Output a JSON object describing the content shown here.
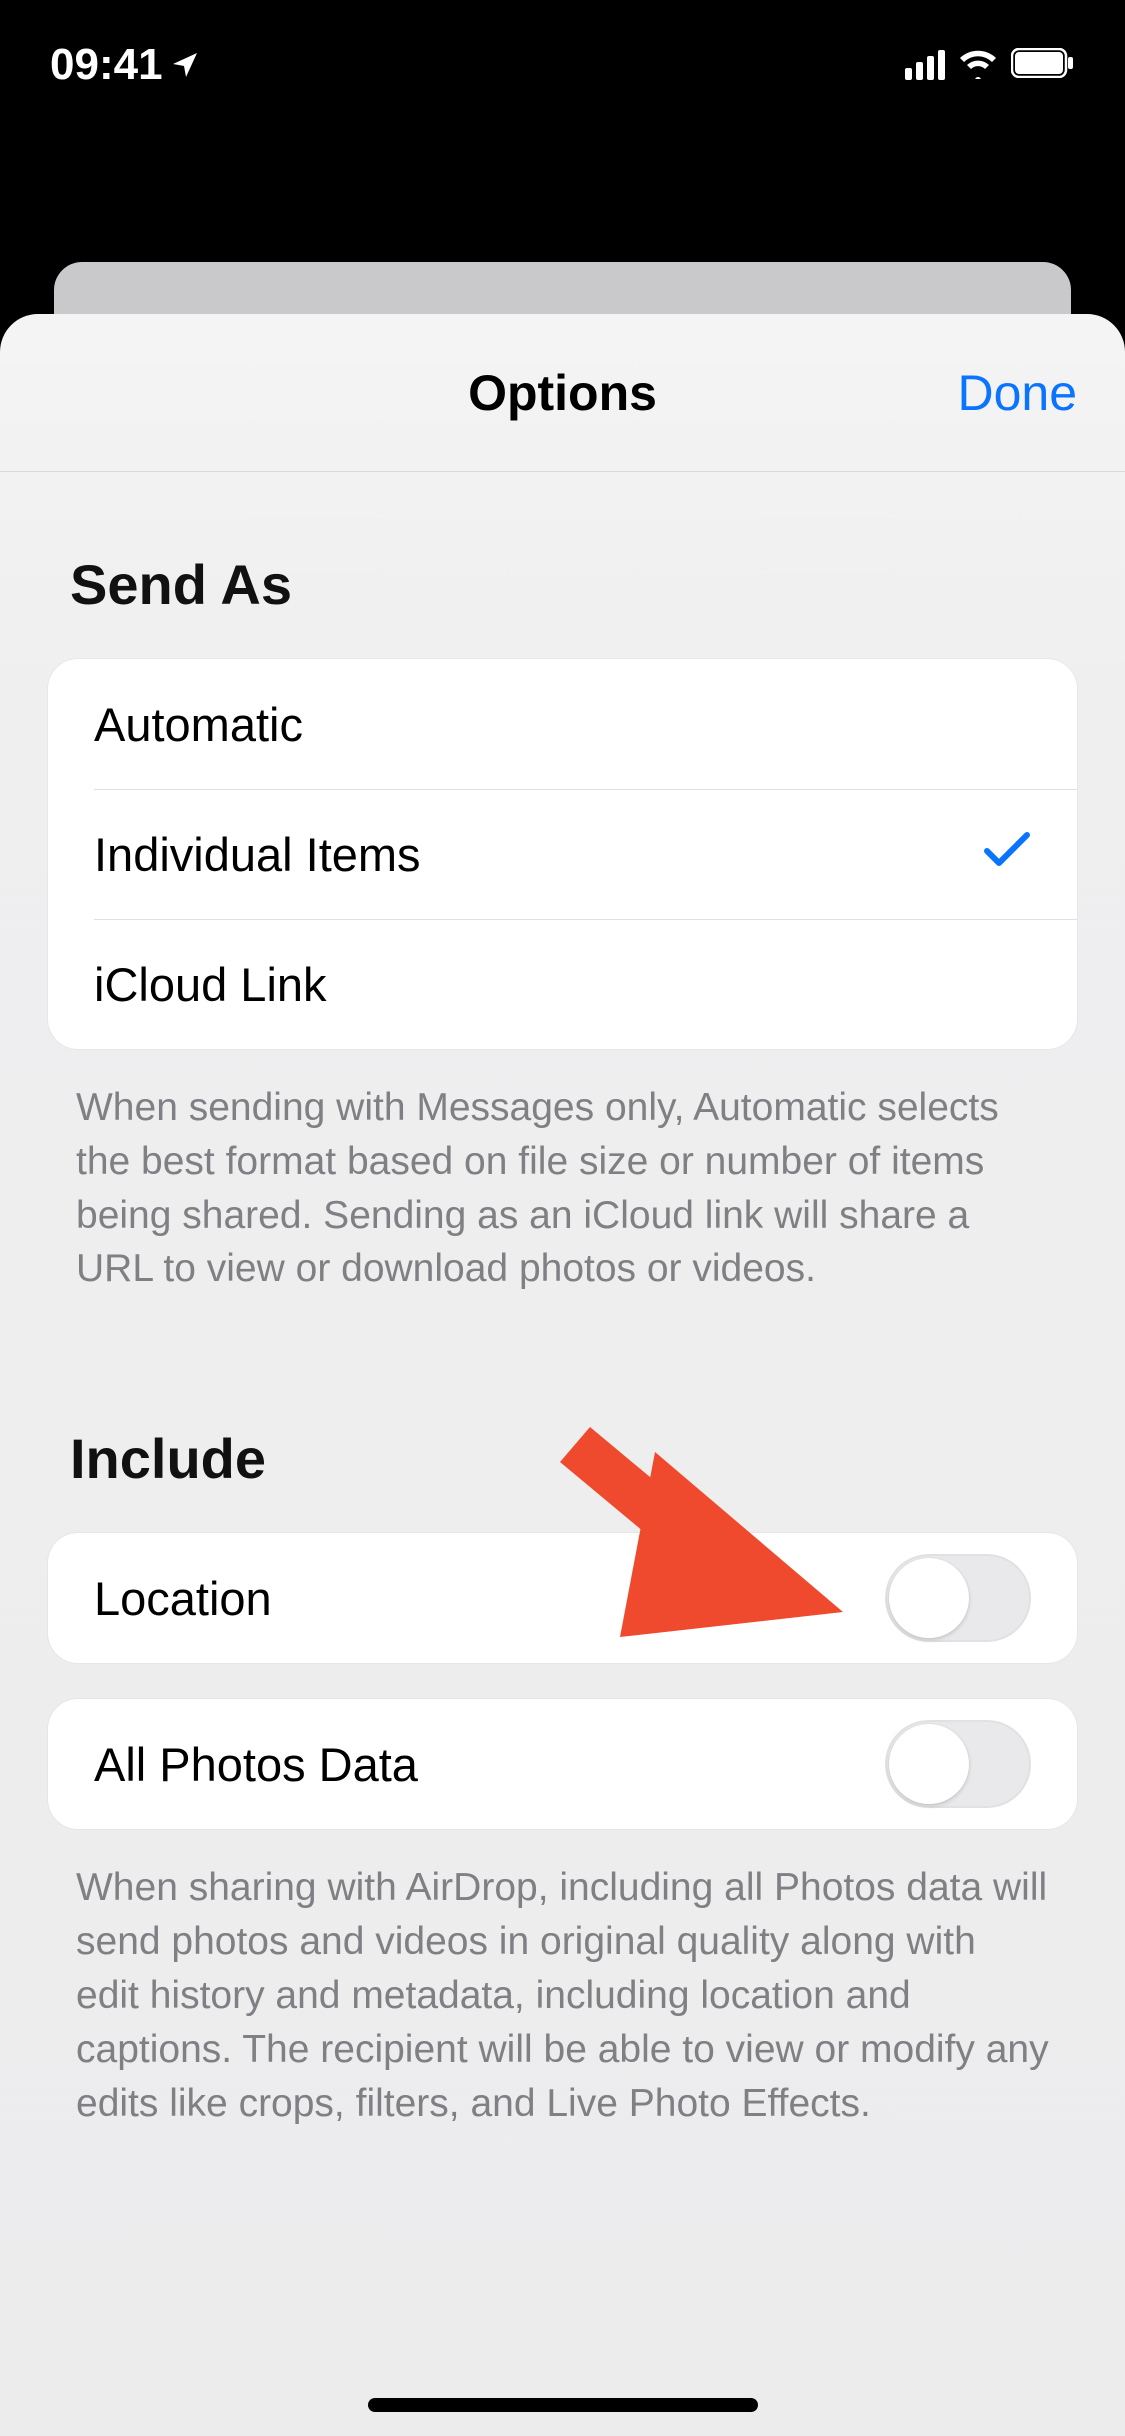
{
  "status_bar": {
    "time": "09:41"
  },
  "sheet": {
    "title": "Options",
    "done_label": "Done"
  },
  "send_as": {
    "title": "Send As",
    "options": [
      {
        "label": "Automatic",
        "selected": false
      },
      {
        "label": "Individual Items",
        "selected": true
      },
      {
        "label": "iCloud Link",
        "selected": false
      }
    ],
    "footer": "When sending with Messages only, Automatic selects the best format based on file size or number of items being shared. Sending as an iCloud link will share a URL to view or download photos or videos."
  },
  "include": {
    "title": "Include",
    "location": {
      "label": "Location",
      "enabled": false
    },
    "all_photos_data": {
      "label": "All Photos Data",
      "enabled": false
    },
    "footer": "When sharing with AirDrop, including all Photos data will send photos and videos in original quality along with edit history and metadata, including location and captions. The recipient will be able to view or modify any edits like crops, filters, and Live Photo Effects."
  },
  "annotation": {
    "arrow_color": "#ef4a2e"
  }
}
